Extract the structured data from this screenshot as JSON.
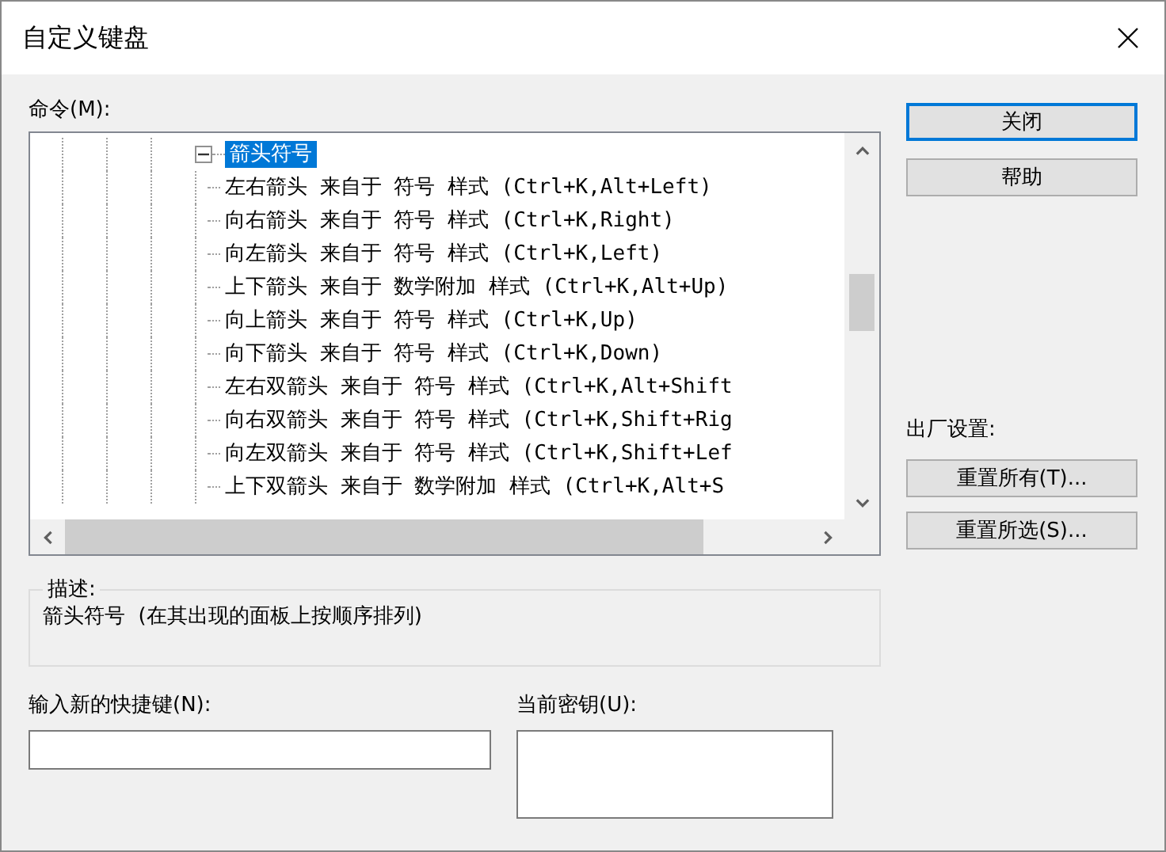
{
  "window": {
    "title": "自定义键盘"
  },
  "commands": {
    "label": "命令(M):",
    "tree": [
      {
        "label": "箭头符号",
        "selected": true,
        "expanded": true,
        "children": [
          {
            "label": "左右箭头 来自于 符号 样式 (Ctrl+K,Alt+Left)",
            "selected": false
          },
          {
            "label": "向右箭头 来自于 符号 样式 (Ctrl+K,Right)",
            "selected": false
          },
          {
            "label": "向左箭头 来自于 符号 样式 (Ctrl+K,Left)",
            "selected": false
          },
          {
            "label": "上下箭头 来自于 数学附加 样式 (Ctrl+K,Alt+Up)",
            "selected": false
          },
          {
            "label": "向上箭头 来自于 符号 样式 (Ctrl+K,Up)",
            "selected": false
          },
          {
            "label": "向下箭头 来自于 符号 样式 (Ctrl+K,Down)",
            "selected": false
          },
          {
            "label": "左右双箭头 来自于 符号 样式 (Ctrl+K,Alt+Shift",
            "selected": false
          },
          {
            "label": "向右双箭头 来自于 符号 样式 (Ctrl+K,Shift+Rig",
            "selected": false
          },
          {
            "label": "向左双箭头 来自于 符号 样式 (Ctrl+K,Shift+Lef",
            "selected": false
          },
          {
            "label": "上下双箭头 来自于 数学附加 样式 (Ctrl+K,Alt+S",
            "selected": false
          }
        ]
      }
    ]
  },
  "buttons": [
    {
      "label": "关闭",
      "default": true
    },
    {
      "label": "帮助",
      "default": false
    }
  ],
  "factory": {
    "label": "出厂设置:",
    "buttons": [
      "重置所有(T)...",
      "重置所选(S)..."
    ]
  },
  "description": {
    "label": "描述:",
    "text": "箭头符号  (在其出现的面板上按顺序排列)"
  },
  "new_shortcut": {
    "label": "输入新的快捷键(N):"
  },
  "current_keys": {
    "label": "当前密钥(U):"
  }
}
